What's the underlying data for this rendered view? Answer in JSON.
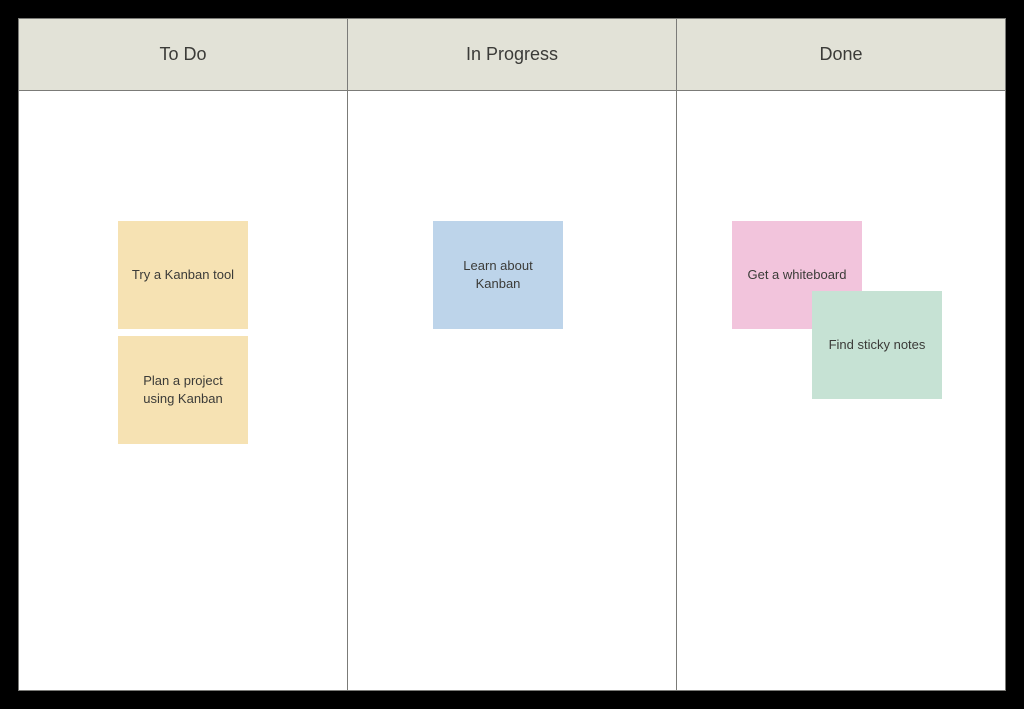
{
  "board": {
    "columns": [
      {
        "title": "To Do"
      },
      {
        "title": "In Progress"
      },
      {
        "title": "Done"
      }
    ]
  },
  "cards": {
    "todo": [
      {
        "label": "Try a Kanban tool",
        "color": "yellow"
      },
      {
        "label": "Plan a project using Kanban",
        "color": "yellow"
      }
    ],
    "in_progress": [
      {
        "label": "Learn about Kanban",
        "color": "blue"
      }
    ],
    "done": [
      {
        "label": "Get a whiteboard",
        "color": "pink"
      },
      {
        "label": "Find sticky notes",
        "color": "mint"
      }
    ]
  }
}
